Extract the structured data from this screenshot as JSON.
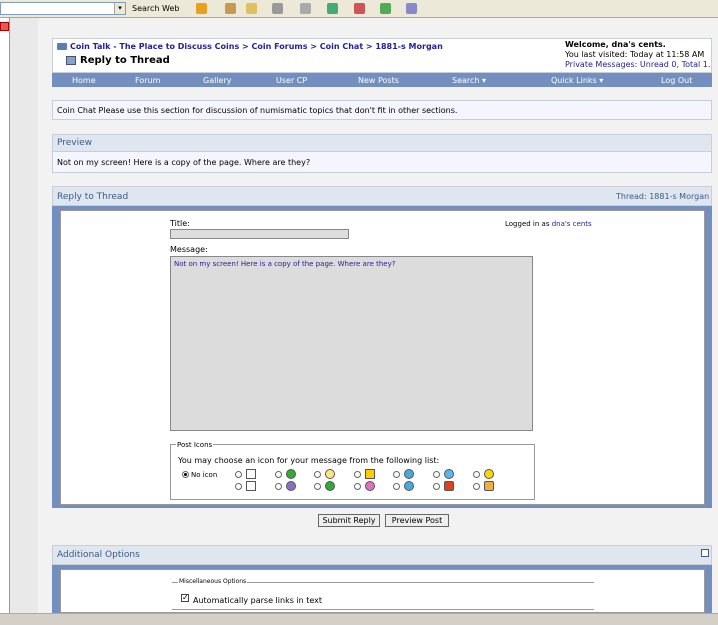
{
  "toolbar": {
    "search_label": "Search Web"
  },
  "header": {
    "breadcrumb": "Coin Talk - The Place to Discuss Coins > Coin Forums > Coin Chat > 1881-s Morgan",
    "title": "Reply to Thread",
    "welcome": "Welcome, dna's cents.",
    "last_visit": "You last visited: Today at 11:58 AM",
    "private_messages": "Private Messages: Unread 0, Total 1."
  },
  "nav": {
    "items": [
      "Home",
      "Forum",
      "Gallery",
      "User CP",
      "New Posts",
      "Search ▾",
      "Quick Links ▾",
      "Log Out"
    ]
  },
  "forum_desc": "Coin Chat Please use this section for discussion of numismatic topics that don't fit in other sections.",
  "preview": {
    "heading": "Preview",
    "text": "Not on my screen! Here is a copy of the page. Where are they?"
  },
  "reply": {
    "heading": "Reply to Thread",
    "thread_label": "Thread: 1881-s Morgan",
    "title_label": "Title:",
    "logged_in_prefix": "Logged in as",
    "logged_in_user": "dna's cents",
    "message_label": "Message:",
    "message_text": "Not on my screen! Here is a copy of the page. Where are they?",
    "post_icons_legend": "Post Icons",
    "post_icons_desc": "You may choose an icon for your message from the following list:",
    "no_icon_label": "No icon",
    "submit_label": "Submit Reply",
    "preview_label": "Preview Post"
  },
  "additional": {
    "heading": "Additional Options",
    "misc_legend": "Miscellaneous Options",
    "parse_links_label": "Automatically parse links in text",
    "parse_links_checked": true
  },
  "colors": {
    "navbar": "#738fbf",
    "section_head": "#dfe6ef",
    "link": "#22229c"
  }
}
